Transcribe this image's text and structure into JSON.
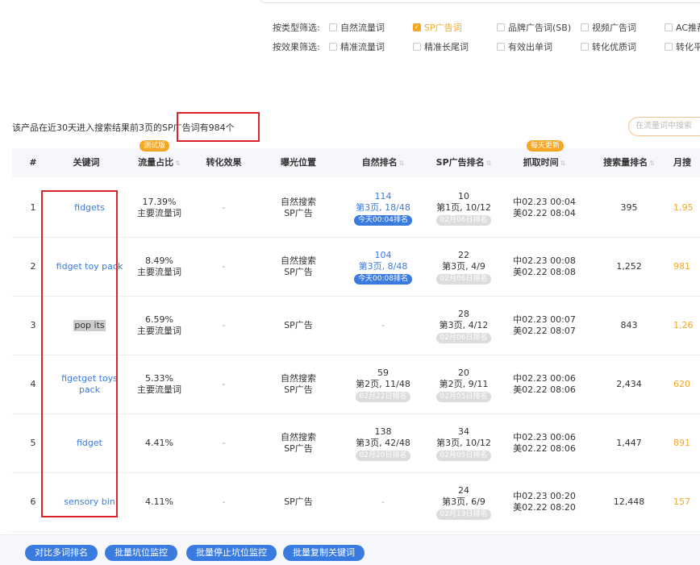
{
  "filters": {
    "type_label": "按类型筛选:",
    "type_options": [
      {
        "label": "自然流量词",
        "checked": false
      },
      {
        "label": "SP广告词",
        "checked": true
      },
      {
        "label": "品牌广告词(SB)",
        "checked": false
      },
      {
        "label": "视频广告词",
        "checked": false
      },
      {
        "label": "AC推荐",
        "checked": false
      }
    ],
    "effect_label": "按效果筛选:",
    "effect_options": [
      {
        "label": "精准流量词",
        "checked": false
      },
      {
        "label": "精准长尾词",
        "checked": false
      },
      {
        "label": "有效出单词",
        "checked": false
      },
      {
        "label": "转化优质词",
        "checked": false
      },
      {
        "label": "转化平",
        "checked": false
      }
    ]
  },
  "summary": {
    "prefix": "该产品在近30天进入搜索结果前3页的SP",
    "boxed": "广告词有984个"
  },
  "search": {
    "placeholder": "在流量词中搜索"
  },
  "headers": {
    "index": "#",
    "keyword": "关键词",
    "traffic_share": "流量占比",
    "traffic_badge": "测试版",
    "conversion": "转化效果",
    "exposure": "曝光位置",
    "organic_rank": "自然排名",
    "sp_rank": "SP广告排名",
    "fetch_time": "抓取时间",
    "fetch_badge": "每天更新",
    "search_volume_rank": "搜索量排名",
    "monthly": "月搜"
  },
  "rows": [
    {
      "index": "1",
      "keyword": "fidgets",
      "share": "17.39%",
      "share_tag": "主要流量词",
      "conversion": "-",
      "exposure": [
        "自然搜索",
        "SP广告"
      ],
      "organic": {
        "rank": "114",
        "page": "第3页, 18/48",
        "tag": "今天00:04排名",
        "active": true
      },
      "sp": {
        "rank": "10",
        "page": "第1页, 10/12",
        "tag": "02月06日排名"
      },
      "time_cn": "中02.23 00:04",
      "time_us": "美02.22 08:04",
      "volume_rank": "395",
      "monthly": "1,95"
    },
    {
      "index": "2",
      "keyword": "fidget toy pack",
      "share": "8.49%",
      "share_tag": "主要流量词",
      "conversion": "-",
      "exposure": [
        "自然搜索",
        "SP广告"
      ],
      "organic": {
        "rank": "104",
        "page": "第3页, 8/48",
        "tag": "今天00:08排名",
        "active": true
      },
      "sp": {
        "rank": "22",
        "page": "第3页, 4/9",
        "tag": "02月06日排名"
      },
      "time_cn": "中02.23 00:08",
      "time_us": "美02.22 08:08",
      "volume_rank": "1,252",
      "monthly": "981"
    },
    {
      "index": "3",
      "keyword": "pop its",
      "share": "6.59%",
      "share_tag": "主要流量词",
      "conversion": "-",
      "exposure": [
        "SP广告"
      ],
      "organic": {
        "rank": "-",
        "page": "",
        "tag": "",
        "active": false
      },
      "sp": {
        "rank": "28",
        "page": "第3页, 4/12",
        "tag": "02月06日排名"
      },
      "time_cn": "中02.23 00:07",
      "time_us": "美02.22 08:07",
      "volume_rank": "843",
      "monthly": "1,26"
    },
    {
      "index": "4",
      "keyword": "figetget toys pack",
      "share": "5.33%",
      "share_tag": "主要流量词",
      "conversion": "-",
      "exposure": [
        "自然搜索",
        "SP广告"
      ],
      "organic": {
        "rank": "59",
        "page": "第2页, 11/48",
        "tag": "02月22日排名",
        "active": false
      },
      "sp": {
        "rank": "20",
        "page": "第2页, 9/11",
        "tag": "02月05日排名"
      },
      "time_cn": "中02.23 00:06",
      "time_us": "美02.22 08:06",
      "volume_rank": "2,434",
      "monthly": "620"
    },
    {
      "index": "5",
      "keyword": "fidget",
      "share": "4.41%",
      "share_tag": "",
      "conversion": "-",
      "exposure": [
        "自然搜索",
        "SP广告"
      ],
      "organic": {
        "rank": "138",
        "page": "第3页, 42/48",
        "tag": "02月20日排名",
        "active": false
      },
      "sp": {
        "rank": "34",
        "page": "第3页, 10/12",
        "tag": "02月05日排名"
      },
      "time_cn": "中02.23 00:06",
      "time_us": "美02.22 08:06",
      "volume_rank": "1,447",
      "monthly": "891"
    },
    {
      "index": "6",
      "keyword": "sensory bin",
      "share": "4.11%",
      "share_tag": "",
      "conversion": "-",
      "exposure": [
        "SP广告"
      ],
      "organic": {
        "rank": "-",
        "page": "",
        "tag": "",
        "active": false
      },
      "sp": {
        "rank": "24",
        "page": "第3页, 6/9",
        "tag": "02月19日排名"
      },
      "time_cn": "中02.23 00:20",
      "time_us": "美02.22 08:20",
      "volume_rank": "12,448",
      "monthly": "157"
    }
  ],
  "footer": {
    "compare": "对比多词排名",
    "batch_monitor": "批量坑位监控",
    "batch_stop": "批量停止坑位监控",
    "batch_copy": "批量复制关键词"
  },
  "colors": {
    "accent": "#f5a623",
    "link": "#3a7be0",
    "highlight_box": "#d9232d"
  }
}
